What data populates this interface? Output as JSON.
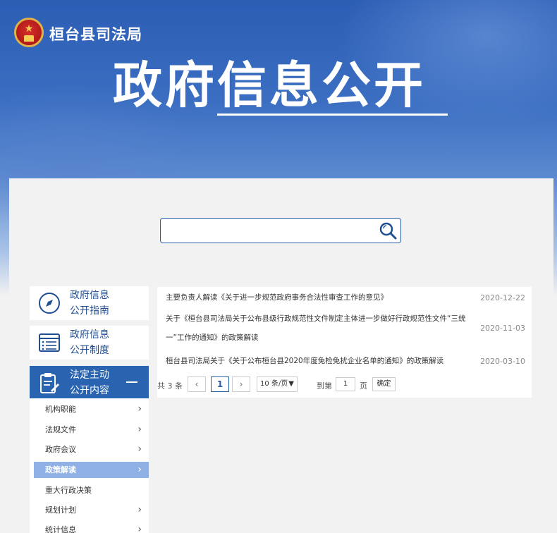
{
  "header": {
    "site_name": "桓台县司法局",
    "big_title": "政府信息公开"
  },
  "search": {
    "placeholder": "",
    "value": ""
  },
  "sidebar": {
    "cards": [
      {
        "label_line1": "政府信息",
        "label_line2": "公开指南",
        "icon": "compass-icon"
      },
      {
        "label_line1": "政府信息",
        "label_line2": "公开制度",
        "icon": "document-list-icon"
      },
      {
        "label_line1": "法定主动",
        "label_line2": "公开内容",
        "icon": "clipboard-edit-icon"
      }
    ],
    "items": [
      {
        "label": "机构职能",
        "has_chevron": true
      },
      {
        "label": "法规文件",
        "has_chevron": true
      },
      {
        "label": "政府会议",
        "has_chevron": true
      },
      {
        "label": "政策解读",
        "has_chevron": true,
        "active": true
      },
      {
        "label": "重大行政决策",
        "has_chevron": false
      },
      {
        "label": "规划计划",
        "has_chevron": true
      },
      {
        "label": "统计信息",
        "has_chevron": true
      }
    ]
  },
  "list": {
    "rows": [
      {
        "title": "主要负责人解读《关于进一步规范政府事务合法性审查工作的意见》",
        "date": "2020-12-22"
      },
      {
        "title_line1": "关于《桓台县司法局关于公布县级行政规范性文件制定主体进一步做好行政规范性文件“三统",
        "title_line2": "一”工作的通知》的政策解读",
        "date": "2020-11-03"
      },
      {
        "title": "桓台县司法局关于《关于公布桓台县2020年度免检免扰企业名单的通知》的政策解读",
        "date": "2020-03-10"
      }
    ]
  },
  "pager": {
    "total": "共 3 条",
    "prev": "‹",
    "current": "1",
    "next": "›",
    "page_size": "10 条/页",
    "goto_label": "到第",
    "goto_value": "1",
    "page_word": "页",
    "ok": "确定"
  },
  "colors": {
    "brand_blue": "#2a64b0",
    "active_sub": "#8fb1e5"
  }
}
